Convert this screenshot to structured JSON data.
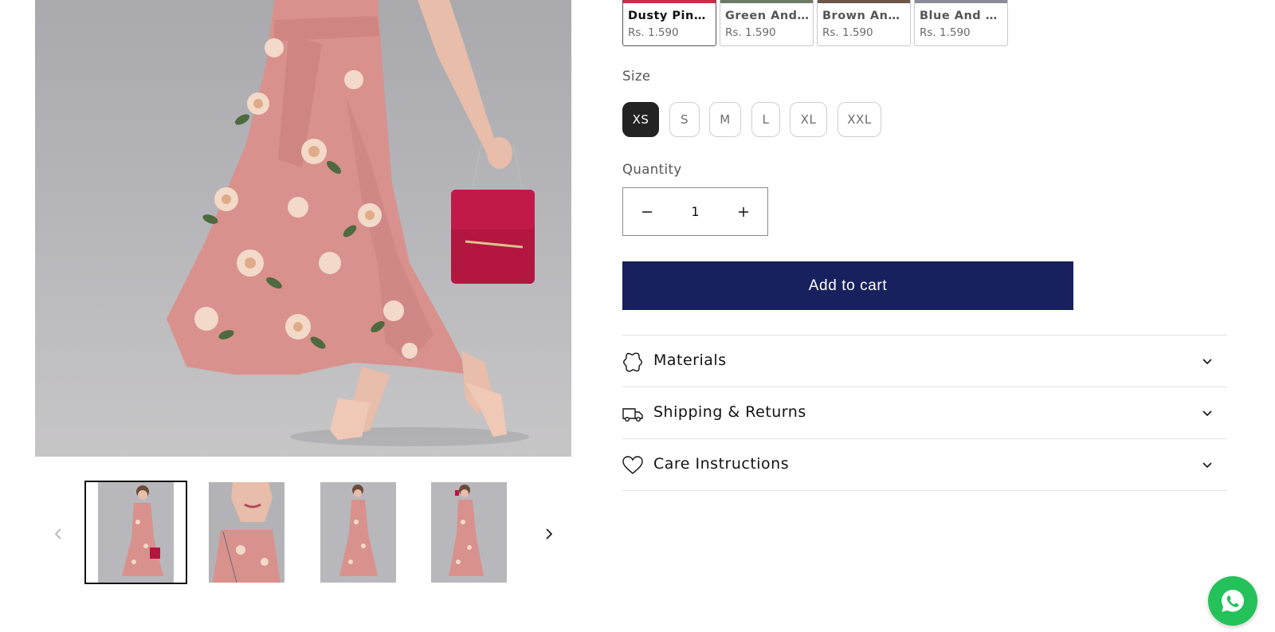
{
  "colors": {
    "accent": "#18215e",
    "size_active": "#232323",
    "whatsapp": "#25c15b",
    "dress": "#d9918d"
  },
  "gallery": {
    "main_image_alt": "",
    "thumbnails": [
      {
        "icon": "dress-front-thumbnail"
      },
      {
        "icon": "dress-closeup-thumbnail"
      },
      {
        "icon": "dress-walk-thumbnail"
      },
      {
        "icon": "dress-side-thumbnail"
      }
    ],
    "prev_icon": "chevron-left-icon",
    "next_icon": "chevron-right-icon"
  },
  "variants": [
    {
      "name": "Dusty Pink ...",
      "price": "Rs. 1.590",
      "swatch": "#c4314b"
    },
    {
      "name": "Green And P...",
      "price": "Rs. 1.590",
      "swatch": "#6d7a66"
    },
    {
      "name": "Brown And ...",
      "price": "Rs. 1.590",
      "swatch": "#6b5647"
    },
    {
      "name": "Blue And Pe...",
      "price": "Rs. 1.590",
      "swatch": "#8a8c99"
    }
  ],
  "size": {
    "label": "Size",
    "options": [
      "XS",
      "S",
      "M",
      "L",
      "XL",
      "XXL"
    ],
    "selected": "XS"
  },
  "quantity": {
    "label": "Quantity",
    "value": "1",
    "decrease_icon": "minus-icon",
    "increase_icon": "plus-icon"
  },
  "cart": {
    "add_label": "Add to cart"
  },
  "accordions": [
    {
      "title": "Materials",
      "icon": "materials-icon"
    },
    {
      "title": "Shipping & Returns",
      "icon": "truck-icon"
    },
    {
      "title": "Care Instructions",
      "icon": "heart-icon"
    }
  ],
  "whatsapp": {
    "icon": "whatsapp-icon"
  }
}
